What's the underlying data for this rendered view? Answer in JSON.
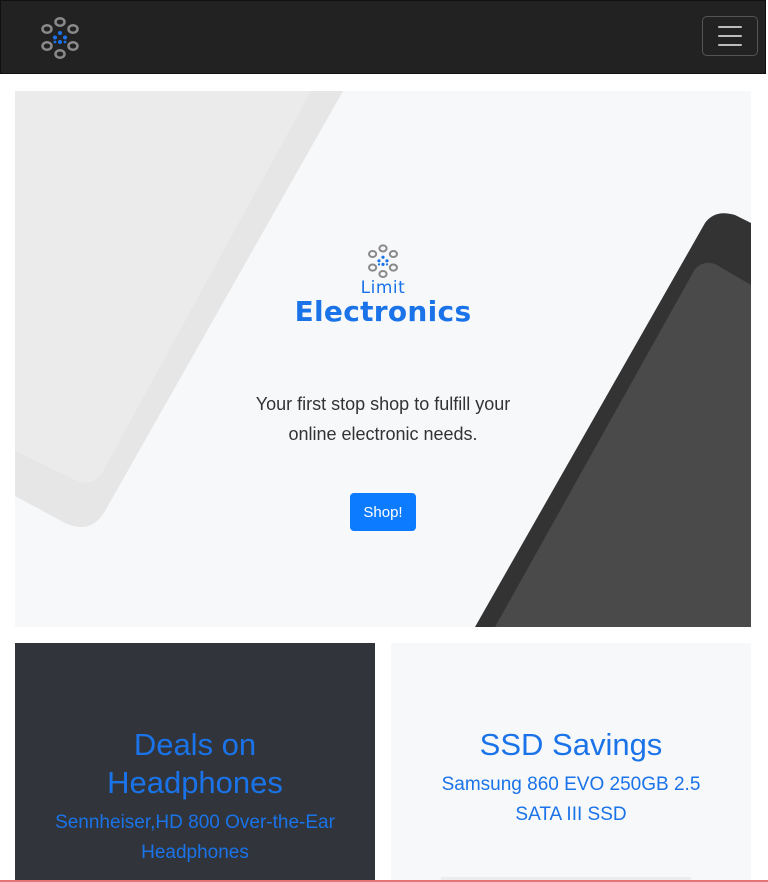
{
  "navbar": {
    "logo_icon": "limit-electronics-logo-icon",
    "menu_icon": "hamburger-menu-icon"
  },
  "hero": {
    "brand_line1": "Limit",
    "brand_line2": "Electronics",
    "tagline": "Your first stop shop to fulfill your online electronic needs.",
    "button_label": "Shop!",
    "colors": {
      "accent": "#1a73e8",
      "button": "#0d7bff"
    }
  },
  "cards": [
    {
      "title": "Deals on Headphones",
      "subtitle": "Sennheiser,HD 800 Over-the-Ear Headphones"
    },
    {
      "title": "SSD Savings",
      "subtitle": "Samsung 860 EVO 250GB 2.5 SATA III SSD"
    }
  ]
}
